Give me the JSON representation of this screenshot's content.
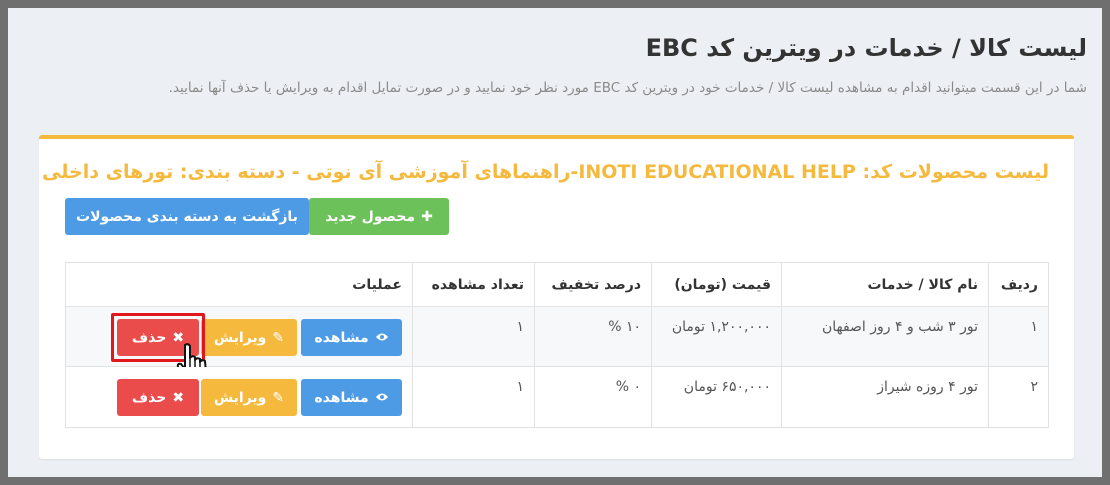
{
  "page": {
    "title": "لیست کالا / خدمات در ویترین کد EBC",
    "description": "شما در این قسمت میتوانید اقدام به مشاهده لیست کالا / خدمات خود در ویترین کد EBC مورد نظر خود نمایید و در صورت تمایل اقدام به ویرایش یا حذف آنها نمایید."
  },
  "box": {
    "title": "لیست محصولات کد: INOTI EDUCATIONAL HELP-راهنماهای آموزشی آی نوتی - دسته بندی: تورهای داخلی",
    "new_button": "محصول جدید",
    "back_button": "بازگشت به دسته بندی محصولات"
  },
  "table": {
    "headers": {
      "index": "ردیف",
      "name": "نام کالا / خدمات",
      "price": "قیمت (تومان)",
      "discount": "درصد تخفیف",
      "views": "تعداد مشاهده",
      "ops": "عملیات"
    },
    "rows": [
      {
        "index": "۱",
        "name": "تور ۳ شب و ۴ روز اصفهان",
        "price": "۱,۲۰۰,۰۰۰ تومان",
        "discount": "۱۰ %",
        "views": "۱"
      },
      {
        "index": "۲",
        "name": "تور ۴ روزه شیراز",
        "price": "۶۵۰,۰۰۰ تومان",
        "discount": "۰ %",
        "views": "۱"
      }
    ],
    "actions": {
      "view": "مشاهده",
      "edit": "ویرایش",
      "delete": "حذف"
    }
  },
  "icons": {
    "plus": "plus-icon",
    "eye": "eye-icon",
    "pencil": "pencil-icon",
    "times": "times-icon",
    "cursor": "hand-cursor-icon"
  },
  "colors": {
    "accent": "#f5b93e",
    "primary": "#4e9be5",
    "success": "#6cc15a",
    "danger": "#ea4c4c",
    "highlight": "#e2171d"
  }
}
